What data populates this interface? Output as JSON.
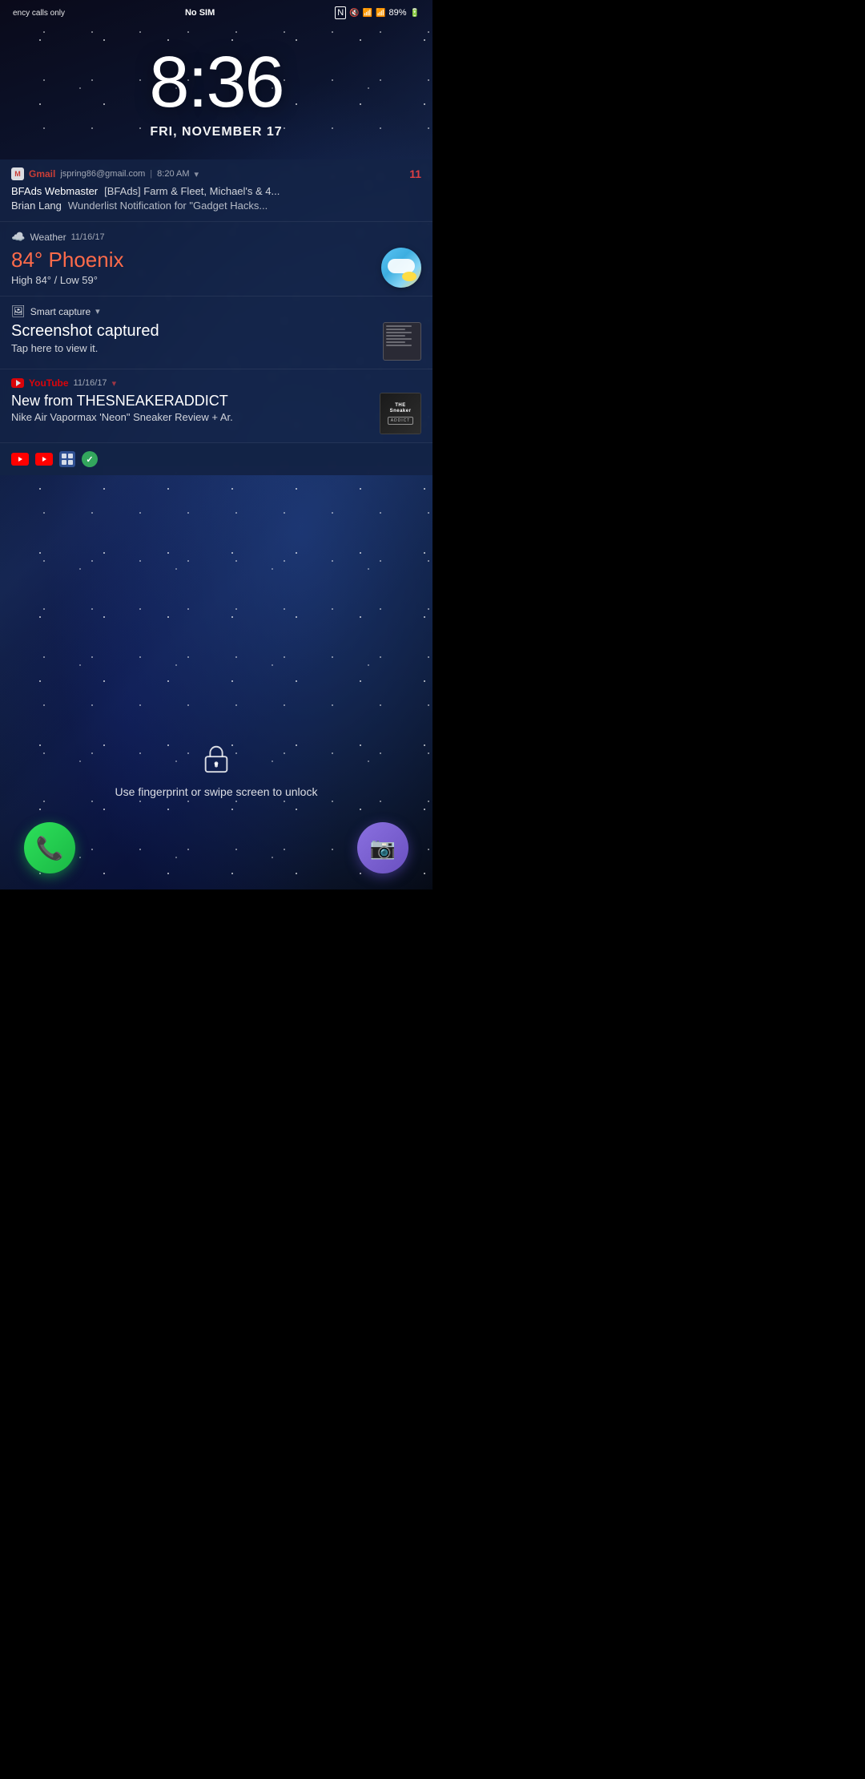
{
  "statusBar": {
    "left": "ency calls only",
    "center": "No SIM",
    "battery": "89%",
    "signal": "▂▄▆█",
    "wifi": "WiFi",
    "icons": [
      "NFC",
      "mute",
      "wifi",
      "signal",
      "battery"
    ]
  },
  "clock": {
    "time": "8:36",
    "date": "FRI, NOVEMBER 17"
  },
  "notifications": {
    "gmail": {
      "appName": "Gmail",
      "account": "jspring86@gmail.com",
      "separator": "|",
      "time": "8:20 AM",
      "badge": "11",
      "row1_sender": "BFAds Webmaster",
      "row1_subject": "[BFAds] Farm & Fleet, Michael's & 4...",
      "row2_sender": "Brian Lang",
      "row2_subject": "Wunderlist Notification for \"Gadget Hacks..."
    },
    "weather": {
      "appName": "Weather",
      "date": "11/16/17",
      "temperature": "84° Phoenix",
      "range": "High 84° / Low 59°"
    },
    "smartCapture": {
      "appName": "Smart capture",
      "title": "Screenshot captured",
      "subtitle": "Tap here to view it."
    },
    "youtube": {
      "appName": "YouTube",
      "date": "11/16/17",
      "title": "New from THESNEAKERADDICT",
      "subtitle": "Nike Air Vapormax 'Neon\" Sneaker Review + Ar.",
      "channelThumb": "THE Sneaker ADDICT"
    }
  },
  "unlock": {
    "text": "Use fingerprint or swipe screen to unlock"
  },
  "dock": {
    "phoneLabel": "Phone",
    "cameraLabel": "Camera"
  }
}
